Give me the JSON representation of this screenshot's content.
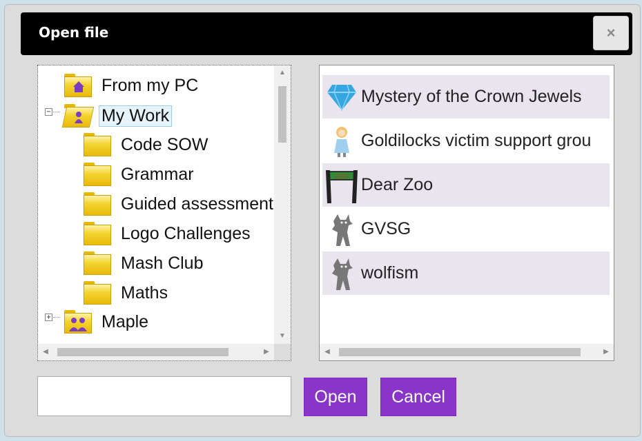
{
  "dialog": {
    "title": "Open file",
    "close_label": "×"
  },
  "tree": {
    "items": [
      {
        "label": "From my PC",
        "icon": "home-folder-icon"
      },
      {
        "label": "My Work",
        "icon": "open-user-folder-icon",
        "expanded": true,
        "selected": true
      },
      {
        "label": "Code SOW",
        "icon": "folder-icon"
      },
      {
        "label": "Grammar",
        "icon": "folder-icon"
      },
      {
        "label": "Guided assessment",
        "icon": "folder-icon"
      },
      {
        "label": "Logo Challenges",
        "icon": "folder-icon"
      },
      {
        "label": "Mash Club",
        "icon": "folder-icon"
      },
      {
        "label": "Maths",
        "icon": "folder-icon"
      },
      {
        "label": "Maple",
        "icon": "group-folder-icon",
        "expanded": false
      }
    ],
    "expander_minus": "−",
    "expander_plus": "+"
  },
  "files": {
    "items": [
      {
        "label": "Mystery of the Crown Jewels",
        "icon": "diamond-icon"
      },
      {
        "label": "Goldilocks victim support grou",
        "icon": "girl-icon"
      },
      {
        "label": "Dear Zoo",
        "icon": "zoo-sign-icon"
      },
      {
        "label": "GVSG",
        "icon": "wolf-icon"
      },
      {
        "label": "wolfism",
        "icon": "wolf-icon"
      }
    ]
  },
  "footer": {
    "filename_value": "",
    "open_label": "Open",
    "cancel_label": "Cancel"
  },
  "colors": {
    "accent": "#8a35c9",
    "titlebar": "#000000",
    "row_alt": "#e9e4ee"
  }
}
